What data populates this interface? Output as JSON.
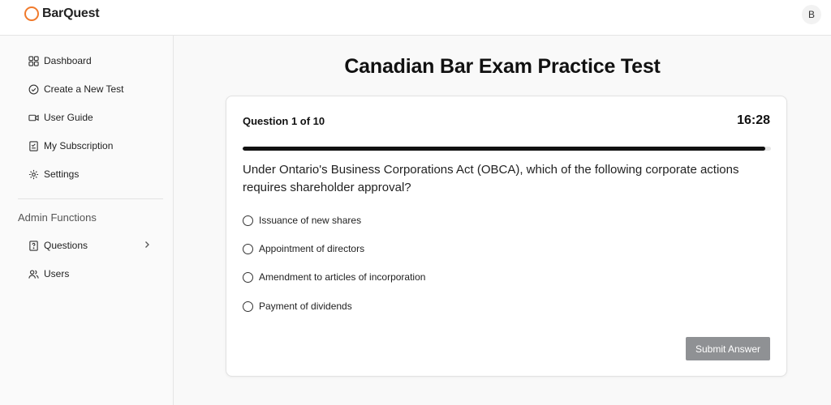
{
  "app": {
    "name": "BarQuest",
    "brand_color": "#f07a2c",
    "user_initial": "B"
  },
  "sidebar": {
    "items": [
      {
        "label": "Dashboard",
        "icon": "dashboard-icon"
      },
      {
        "label": "Create a New Test",
        "icon": "check-circle-icon"
      },
      {
        "label": "User Guide",
        "icon": "video-icon"
      },
      {
        "label": "My Subscription",
        "icon": "receipt-icon"
      },
      {
        "label": "Settings",
        "icon": "gear-icon"
      }
    ],
    "admin_heading": "Admin Functions",
    "admin_items": [
      {
        "label": "Questions",
        "icon": "question-file-icon",
        "has_submenu": true
      },
      {
        "label": "Users",
        "icon": "users-icon"
      }
    ]
  },
  "main": {
    "title": "Canadian Bar Exam Practice Test",
    "question": {
      "counter": "Question 1 of 10",
      "timer": "16:28",
      "progress_percent": 99,
      "text": "Under Ontario's Business Corporations Act (OBCA), which of the following corporate actions requires shareholder approval?",
      "options": [
        "Issuance of new shares",
        "Appointment of directors",
        "Amendment to articles of incorporation",
        "Payment of dividends"
      ],
      "submit_label": "Submit Answer"
    }
  }
}
